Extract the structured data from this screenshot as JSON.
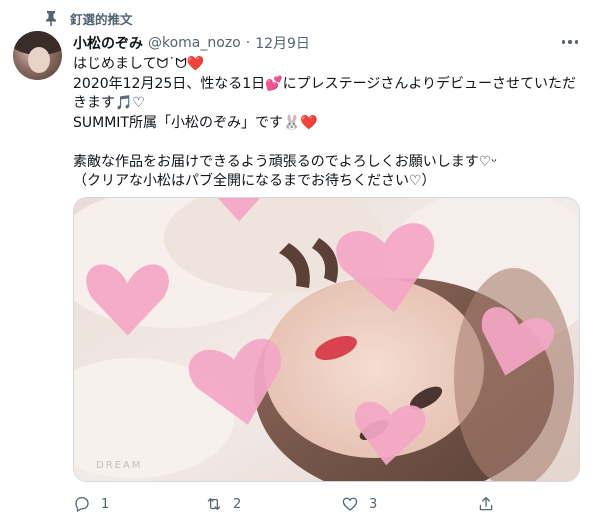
{
  "pinned": {
    "label": "釘選的推文",
    "icon": "pin-icon"
  },
  "author": {
    "name": "小松のぞみ",
    "handle": "@koma_nozo",
    "separator": "·",
    "date": "12月9日"
  },
  "tweet": {
    "lines": [
      "はじめましてᗢ˙ᗢ❤️",
      "2020年12月25日、性なる1日💕にプレステージさんよりデビューさせていただ",
      "きます🎵♡",
      "SUMMIT所属「小松のぞみ」です🐰❤️",
      "",
      "素敵な作品をお届けできるよう頑張るのでよろしくお願いします♡ᵕ",
      "（クリアな小松はパブ全開になるまでお待ちください♡）"
    ]
  },
  "media": {
    "watermark": "DREAM"
  },
  "actions": {
    "reply": {
      "icon": "reply-icon",
      "count": "1"
    },
    "retweet": {
      "icon": "retweet-icon",
      "count": "2"
    },
    "like": {
      "icon": "like-icon",
      "count": "3"
    },
    "share": {
      "icon": "share-icon",
      "count": ""
    }
  },
  "colors": {
    "text": "#0f1419",
    "secondary": "#536471",
    "heart": "#f4a7c5"
  }
}
